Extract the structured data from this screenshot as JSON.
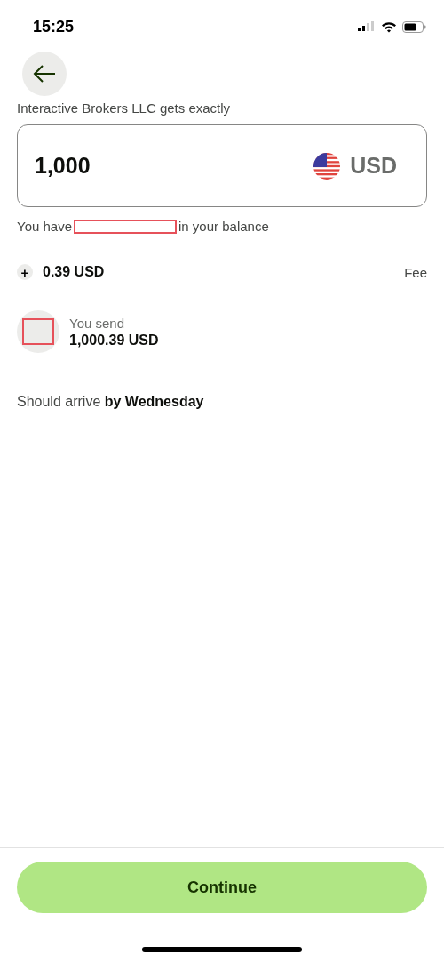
{
  "status_bar": {
    "time": "15:25"
  },
  "recipient_label": "Interactive Brokers LLC gets exactly",
  "amount_field": {
    "value": "1,000",
    "currency": "USD"
  },
  "balance": {
    "before": "You have",
    "after": "in your balance",
    "redacted": true
  },
  "fee": {
    "sign": "+",
    "amount": "0.39 USD",
    "label": "Fee"
  },
  "send": {
    "label": "You send",
    "amount": "1,000.39 USD",
    "icon_redacted": true
  },
  "arrival": "Should arrive **by Wednesday**",
  "continue_button": "Continue"
}
